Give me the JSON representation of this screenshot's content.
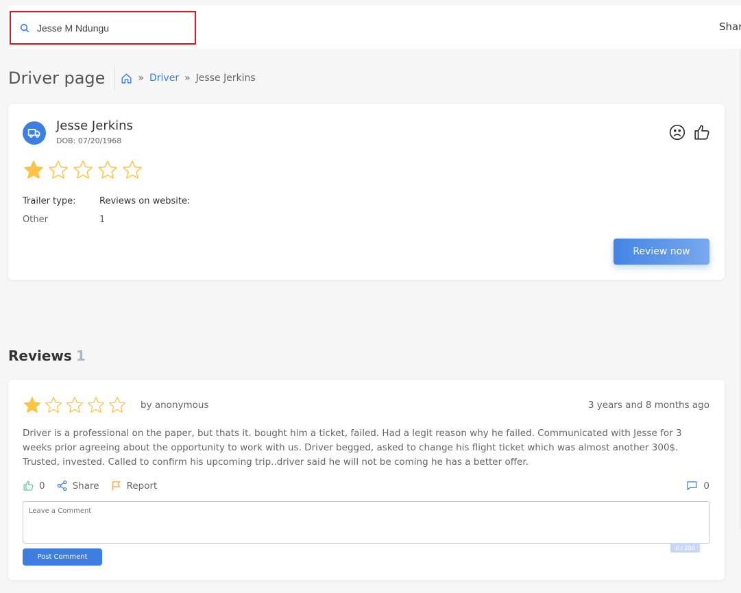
{
  "search": {
    "value": "Jesse M Ndungu"
  },
  "topbar": {
    "share_label": "Share"
  },
  "header": {
    "title": "Driver page"
  },
  "breadcrumb": {
    "driver": "Driver",
    "current": "Jesse Jerkins",
    "separator": "»"
  },
  "driver": {
    "name": "Jesse Jerkins",
    "dob": "DOB: 07/20/1968",
    "rating": 1,
    "max_rating": 5,
    "trailer_type_label": "Trailer type:",
    "trailer_type_value": "Other",
    "reviews_label": "Reviews on website:",
    "reviews_value": "1",
    "review_button": "Review now"
  },
  "reviews": {
    "heading": "Reviews",
    "count": "1",
    "items": [
      {
        "rating": 1,
        "author": "by anonymous",
        "time": "3 years and 8 months ago",
        "text": "Driver is a professional on the paper, but thats it. bought him a ticket, failed. Had a legit reason why he failed. Communicated with Jesse for 3 weeks prior agreeing about the opportunity to work with us. Driver begged, asked to change his flight ticket which was almost another 300$. Trusted, invested. Called to confirm his upcoming trip..driver said he will not be coming he has a better offer.",
        "likes": "0",
        "share_label": "Share",
        "report_label": "Report",
        "comments": "0",
        "comment_placeholder": "Leave a Comment",
        "char_counter": "0 / 200",
        "post_button": "Post Comment"
      }
    ]
  },
  "colors": {
    "accent": "#3d7ee0",
    "star": "#fdc444",
    "highlight_border": "#e0161c",
    "like_green": "#5fcf8c",
    "report_orange": "#f5a34a"
  }
}
